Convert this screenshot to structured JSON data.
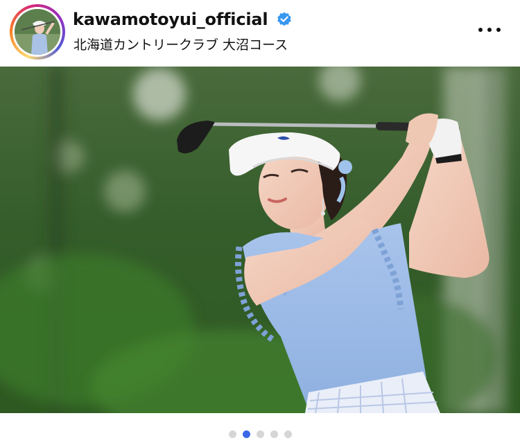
{
  "post": {
    "username": "kawamotoyui_official",
    "verified_icon": "verified-badge-icon",
    "location": "北海道カントリークラブ 大沼コース",
    "more_icon": "more-horizontal-icon",
    "photo_description_icon": "golfer-photo"
  },
  "carousel": {
    "total": 5,
    "active_index": 1
  },
  "colors": {
    "verified": "#3897f0",
    "active_dot": "#3b67e8",
    "inactive_dot": "#d6d6d6"
  }
}
